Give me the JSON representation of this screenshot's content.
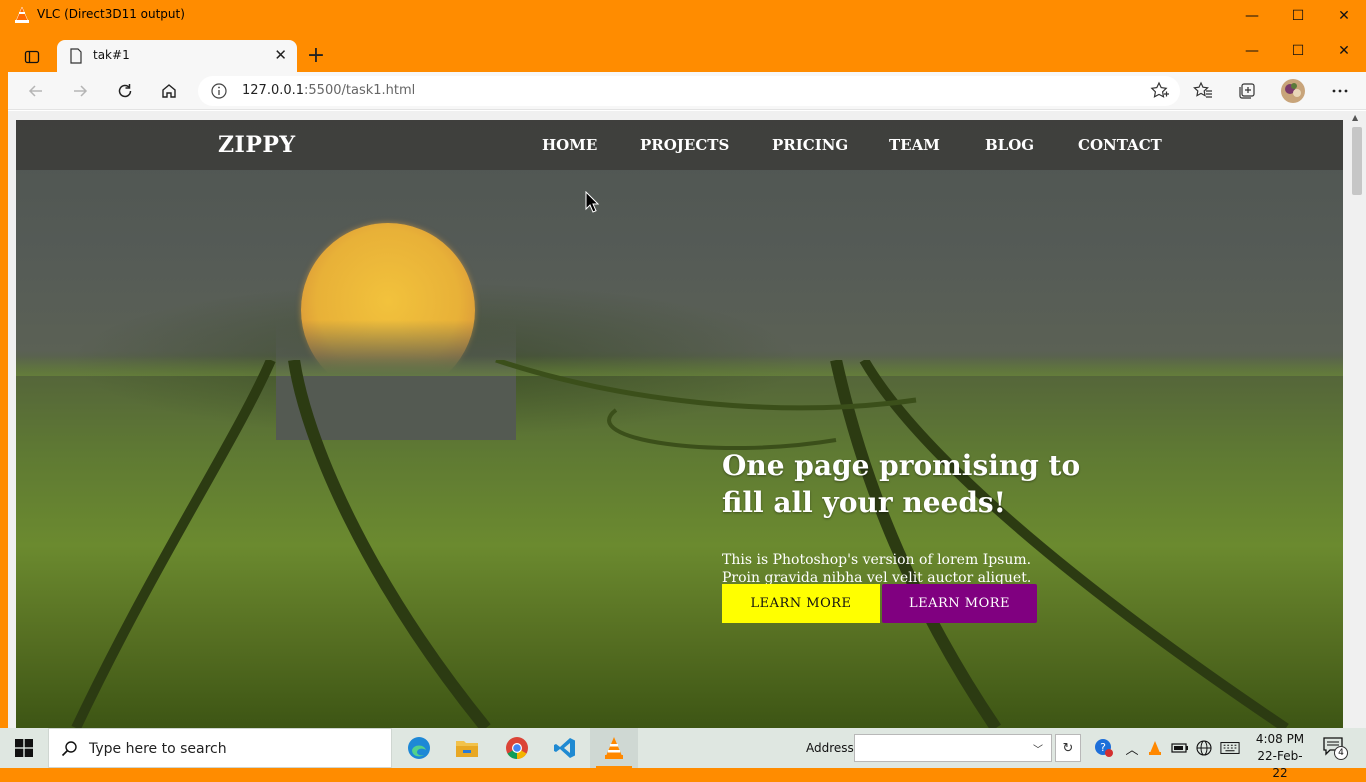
{
  "vlc_window": {
    "title": "VLC (Direct3D11 output)",
    "minimize_glyph": "—",
    "maximize_glyph": "☐",
    "close_glyph": "✕"
  },
  "browser": {
    "tab": {
      "label": "tak#1",
      "close_glyph": "✕"
    },
    "new_tab_glyph": "+",
    "url_host": "127.0.0.1",
    "url_rest": ":5500/task1.html"
  },
  "site": {
    "brand": "ZIPPY",
    "nav": [
      "HOME",
      "PROJECTS",
      "PRICING",
      "TEAM",
      "BLOG",
      "CONTACT"
    ],
    "hero_title_line1": "One page promising to",
    "hero_title_line2": "fill all your needs!",
    "hero_subtitle": "This is Photoshop's version of lorem Ipsum. Proin gravida nibha vel velit auctor aliquet.",
    "button_primary": "LEARN MORE",
    "button_secondary": "LEARN MORE",
    "colors": {
      "nav_bg": "#3c3c3a",
      "button_primary": "#ffff00",
      "button_secondary": "#800080"
    }
  },
  "taskbar": {
    "search_placeholder": "Type here to search",
    "address_label": "Address",
    "time": "4:08 PM",
    "date": "22-Feb-22",
    "notification_count": "4"
  },
  "colors": {
    "vlc_accent": "#ff8c00",
    "taskbar_bg": "#dfe7e1"
  }
}
